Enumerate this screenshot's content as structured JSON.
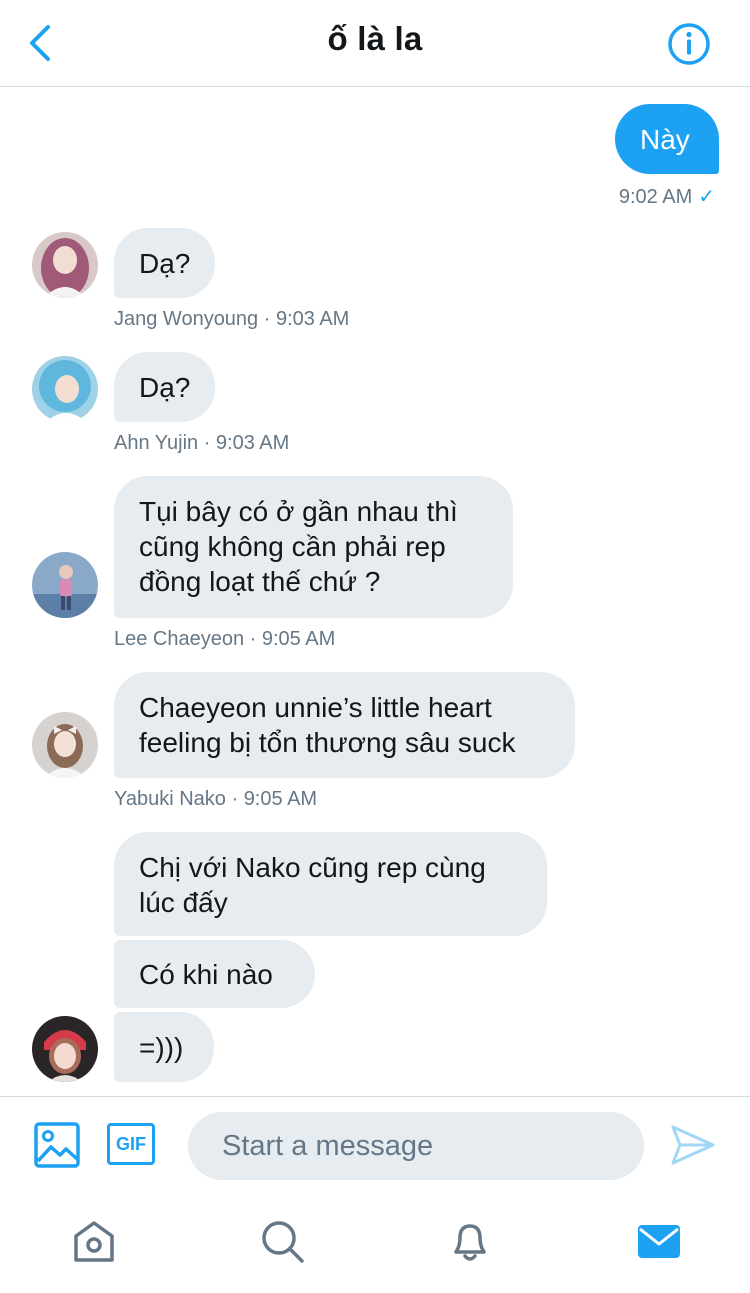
{
  "header": {
    "title": "ố là la"
  },
  "messages": {
    "m0": {
      "text": "Này",
      "meta": "9:02 AM"
    },
    "m1": {
      "text": "Dạ?",
      "meta": "Jang Wonyoung · 9:03 AM"
    },
    "m2": {
      "text": "Dạ?",
      "meta": "Ahn Yujin · 9:03 AM"
    },
    "m3": {
      "lines": [
        "Tụi bây có ở gần nhau thì",
        "cũng không cần phải rep",
        "đồng loạt thế chứ ?"
      ],
      "meta": "Lee Chaeyeon · 9:05 AM"
    },
    "m4": {
      "lines": [
        "Chaeyeon unnie’s little heart",
        "feeling bị tổn thương sâu suck"
      ],
      "meta": "Yabuki Nako · 9:05 AM"
    },
    "m5": {
      "lines": [
        "Chị với Nako cũng rep cùng",
        "lúc đấy"
      ]
    },
    "m6": {
      "text": "Có khi nào"
    },
    "m7": {
      "text": "=)))"
    }
  },
  "composer": {
    "gif_label": "GIF",
    "placeholder": "Start a message"
  },
  "colors": {
    "accent": "#1da1f2",
    "bubble_in": "#e6ecf0",
    "meta": "#657786"
  },
  "icons": [
    "back-icon",
    "info-icon",
    "image-icon",
    "gif-icon",
    "send-icon",
    "home-icon",
    "search-icon",
    "bell-icon",
    "mail-icon"
  ]
}
